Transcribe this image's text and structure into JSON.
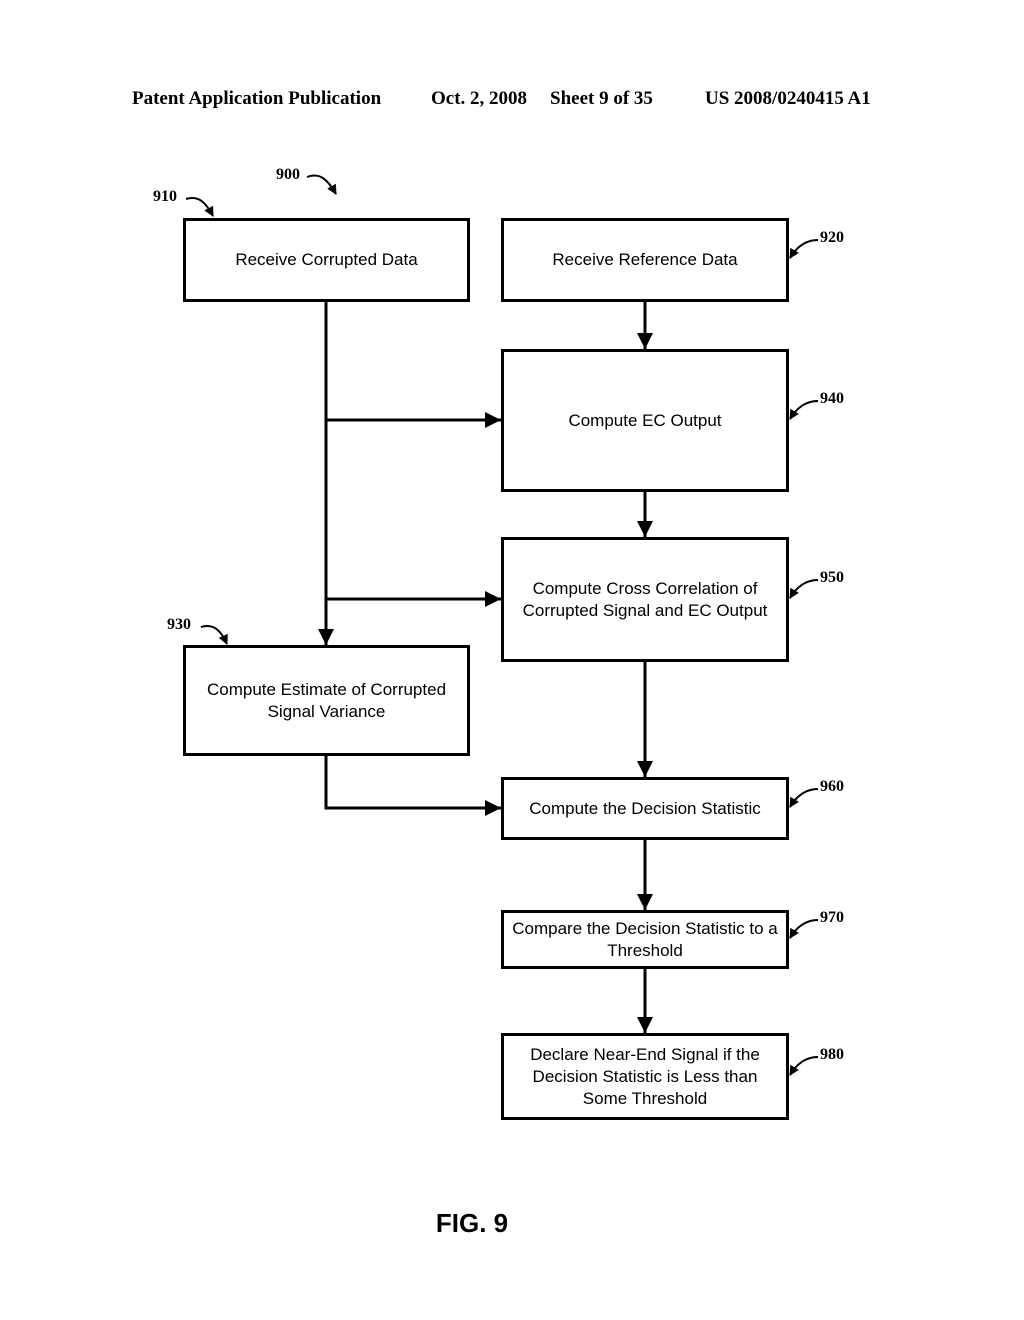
{
  "header": {
    "publication": "Patent Application Publication",
    "date": "Oct. 2, 2008",
    "sheet": "Sheet 9 of 35",
    "number": "US 2008/0240415 A1"
  },
  "diagram": {
    "ref": "900",
    "nodes": [
      {
        "id": "910",
        "ref": "910",
        "label": "Receive Corrupted Data"
      },
      {
        "id": "920",
        "ref": "920",
        "label": "Receive Reference Data"
      },
      {
        "id": "930",
        "ref": "930",
        "label": "Compute Estimate of Corrupted Signal Variance"
      },
      {
        "id": "940",
        "ref": "940",
        "label": "Compute EC Output"
      },
      {
        "id": "950",
        "ref": "950",
        "label": "Compute Cross Correlation of Corrupted Signal and EC Output"
      },
      {
        "id": "960",
        "ref": "960",
        "label": "Compute the Decision Statistic"
      },
      {
        "id": "970",
        "ref": "970",
        "label": "Compare the Decision Statistic to a Threshold"
      },
      {
        "id": "980",
        "ref": "980",
        "label": "Declare Near-End Signal if the Decision Statistic is Less than Some Threshold"
      }
    ],
    "edges": [
      {
        "from": "920",
        "to": "940"
      },
      {
        "from": "910",
        "to": "940"
      },
      {
        "from": "910",
        "to": "950"
      },
      {
        "from": "910",
        "to": "930"
      },
      {
        "from": "940",
        "to": "950"
      },
      {
        "from": "950",
        "to": "960"
      },
      {
        "from": "930",
        "to": "960"
      },
      {
        "from": "960",
        "to": "970"
      },
      {
        "from": "970",
        "to": "980"
      }
    ]
  },
  "figure_label": "FIG. 9"
}
